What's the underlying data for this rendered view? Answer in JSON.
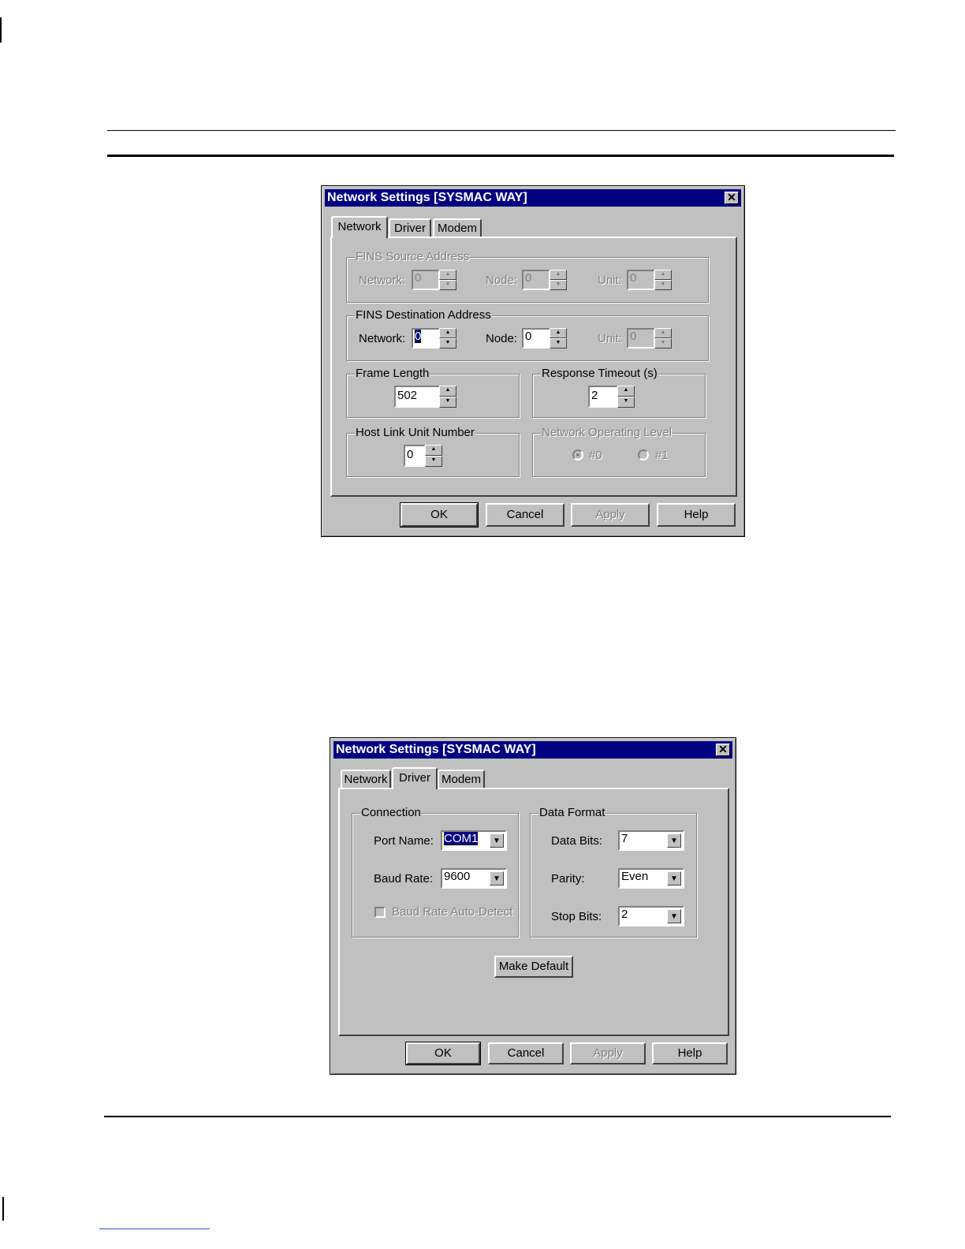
{
  "dialog1": {
    "title": "Network Settings [SYSMAC WAY]",
    "tabs": [
      {
        "label": "Network"
      },
      {
        "label": "Driver"
      },
      {
        "label": "Modem"
      }
    ],
    "fins_source": {
      "title": "FINS Source Address",
      "network_label": "Network:",
      "network_value": "0",
      "node_label": "Node:",
      "node_value": "0",
      "unit_label": "Unit:",
      "unit_value": "0"
    },
    "fins_dest": {
      "title": "FINS Destination Address",
      "network_label": "Network:",
      "network_value": "0",
      "node_label": "Node:",
      "node_value": "0",
      "unit_label": "Unit:",
      "unit_value": "0"
    },
    "frame_length": {
      "title": "Frame Length",
      "value": "502"
    },
    "response_timeout": {
      "title": "Response Timeout (s)",
      "value": "2"
    },
    "host_link": {
      "title": "Host Link Unit Number",
      "value": "0"
    },
    "operating_level": {
      "title": "Network Operating Level",
      "option0": "#0",
      "option1": "#1",
      "selected": "#0"
    },
    "buttons": {
      "ok": "OK",
      "cancel": "Cancel",
      "apply": "Apply",
      "help": "Help"
    }
  },
  "dialog2": {
    "title": "Network Settings [SYSMAC WAY]",
    "tabs": [
      {
        "label": "Network"
      },
      {
        "label": "Driver"
      },
      {
        "label": "Modem"
      }
    ],
    "connection": {
      "title": "Connection",
      "port_label": "Port Name:",
      "port_value": "COM1",
      "baud_label": "Baud Rate:",
      "baud_value": "9600",
      "autodetect_label": "Baud Rate Auto-Detect"
    },
    "data_format": {
      "title": "Data Format",
      "databits_label": "Data Bits:",
      "databits_value": "7",
      "parity_label": "Parity:",
      "parity_value": "Even",
      "stopbits_label": "Stop Bits:",
      "stopbits_value": "2"
    },
    "make_default": "Make Default",
    "buttons": {
      "ok": "OK",
      "cancel": "Cancel",
      "apply": "Apply",
      "help": "Help"
    }
  }
}
